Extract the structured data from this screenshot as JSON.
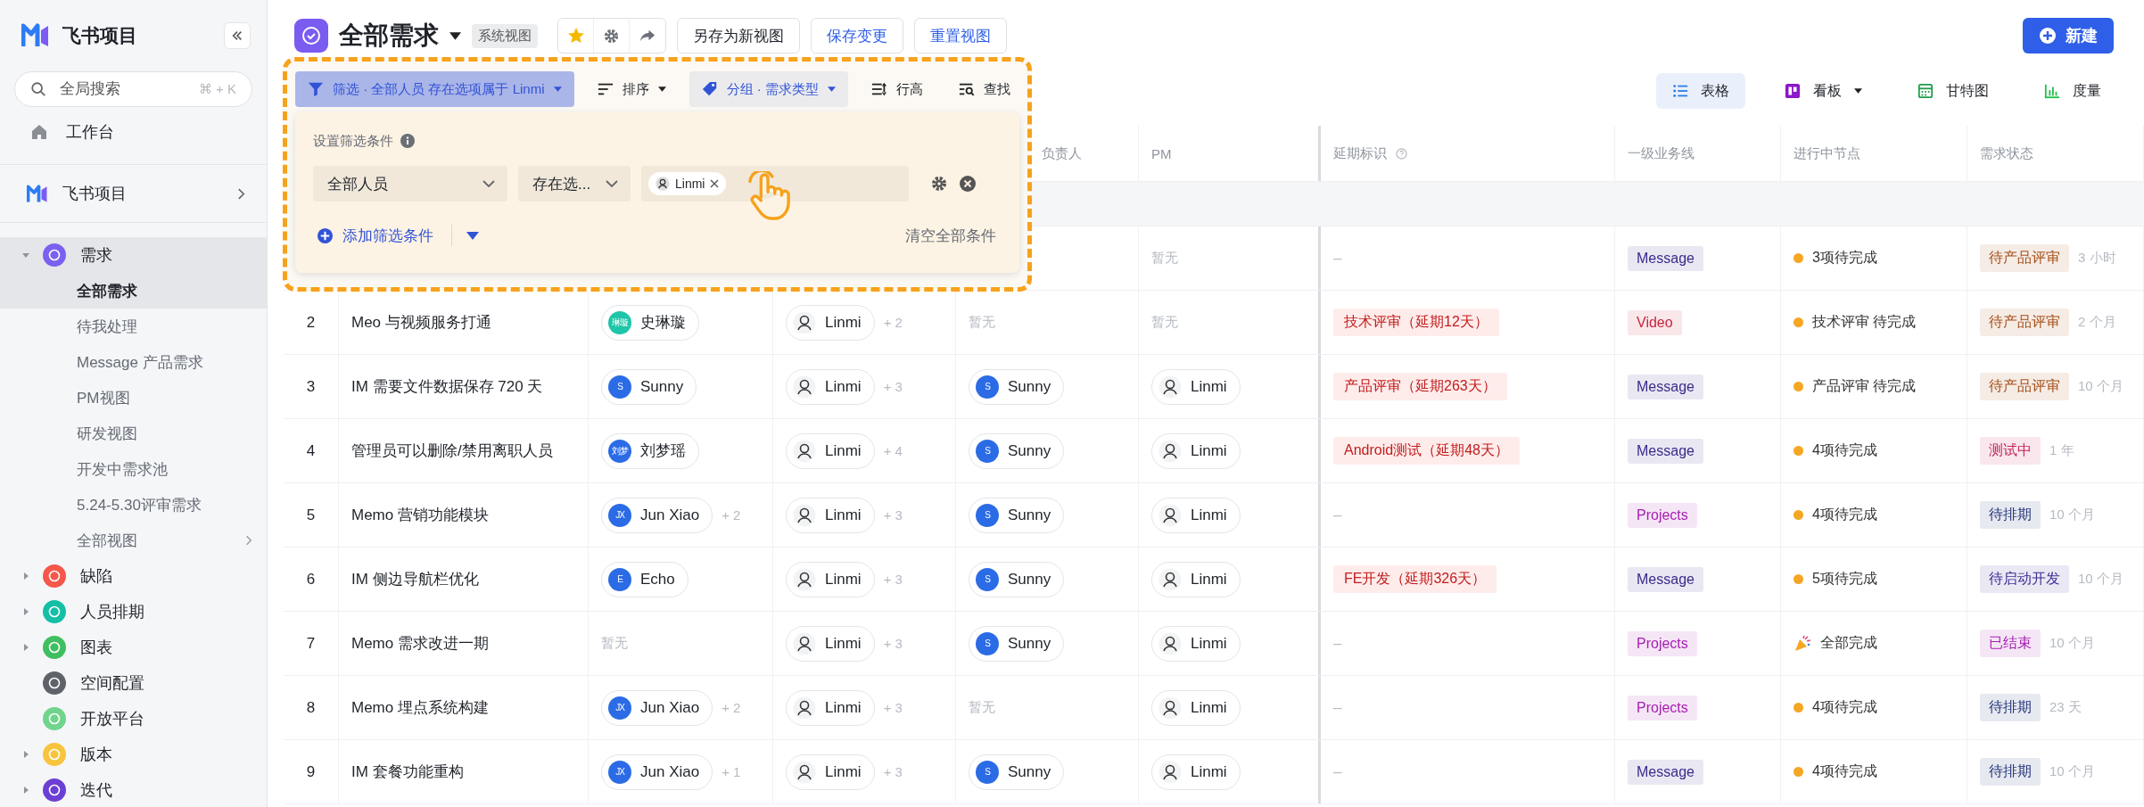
{
  "sidebar": {
    "title": "飞书项目",
    "search": {
      "placeholder": "全局搜索",
      "shortcut": "⌘ + K"
    },
    "home": "工作台",
    "space": "飞书项目",
    "nav": [
      {
        "label": "需求",
        "color": "#7b61f0",
        "kind": "group",
        "expanded": true,
        "selected": true,
        "children": [
          {
            "label": "全部需求",
            "selected": true,
            "more": false
          },
          {
            "label": "待我处理",
            "selected": false,
            "more": false
          },
          {
            "label": "Message 产品需求",
            "selected": false,
            "more": false
          },
          {
            "label": "PM视图",
            "selected": false,
            "more": false
          },
          {
            "label": "研发视图",
            "selected": false,
            "more": false
          },
          {
            "label": "开发中需求池",
            "selected": false,
            "more": false
          },
          {
            "label": "5.24-5.30评审需求",
            "selected": false,
            "more": false
          },
          {
            "label": "全部视图",
            "selected": false,
            "more": true
          }
        ]
      },
      {
        "label": "缺陷",
        "color": "#f5574a",
        "kind": "group",
        "expanded": false,
        "selected": false
      },
      {
        "label": "人员排期",
        "color": "#14bfa6",
        "kind": "group",
        "expanded": false,
        "selected": false
      },
      {
        "label": "图表",
        "color": "#3fbf5f",
        "kind": "group",
        "expanded": false,
        "selected": false
      },
      {
        "label": "空间配置",
        "color": "#5f6369",
        "kind": "link",
        "selected": false
      },
      {
        "label": "开放平台",
        "color": "#6fd48c",
        "kind": "link",
        "selected": false
      },
      {
        "label": "版本",
        "color": "#f7c43d",
        "kind": "group",
        "expanded": false,
        "selected": false
      },
      {
        "label": "迭代",
        "color": "#6b3fd4",
        "kind": "group",
        "expanded": false,
        "selected": false
      }
    ]
  },
  "header": {
    "title": "全部需求",
    "badge": "系统视图",
    "buttons": [
      {
        "label": "另存为新视图",
        "kind": "plain"
      },
      {
        "label": "保存变更",
        "kind": "primary_text"
      },
      {
        "label": "重置视图",
        "kind": "primary_text"
      }
    ],
    "new_button": "新建"
  },
  "toolbar": {
    "items": [
      {
        "label": "筛选 · 全部人员 存在选项属于 Linmi",
        "kind": "filter",
        "active": true,
        "dropdown": true
      },
      {
        "label": "排序",
        "kind": "sort",
        "active": false,
        "dropdown": true
      },
      {
        "label": "分组 · 需求类型",
        "kind": "group",
        "active": true,
        "dropdown": true
      },
      {
        "label": "行高",
        "kind": "height",
        "active": false,
        "dropdown": false
      },
      {
        "label": "查找",
        "kind": "find",
        "active": false,
        "dropdown": false
      }
    ],
    "views": [
      {
        "label": "表格",
        "kind": "table",
        "selected": true,
        "dropdown": false
      },
      {
        "label": "看板",
        "kind": "board",
        "selected": false,
        "dropdown": true
      },
      {
        "label": "甘特图",
        "kind": "gantt",
        "selected": false,
        "dropdown": false
      },
      {
        "label": "度量",
        "kind": "metric",
        "selected": false,
        "dropdown": false
      }
    ]
  },
  "filter_panel": {
    "title": "设置筛选条件",
    "field": "全部人员",
    "operator": "存在选...",
    "value": "Linmi",
    "add": "添加筛选条件",
    "clear": "清空全部条件"
  },
  "table": {
    "columns": [
      {
        "label": "负责人",
        "help": false
      },
      {
        "label": "PM",
        "help": false
      },
      {
        "label": "延期标识",
        "help": true
      },
      {
        "label": "一级业务线",
        "help": false
      },
      {
        "label": "进行中节点",
        "help": false
      },
      {
        "label": "需求状态",
        "help": false
      }
    ],
    "rows": [
      {
        "pm": {
          "empty": "暂无"
        },
        "delay": {
          "kind": "none",
          "text": "–"
        },
        "line": {
          "text": "Message",
          "color": "#3b2a8c"
        },
        "node": {
          "kind": "pending",
          "text": "3项待完成"
        },
        "status": {
          "text": "待产品评审",
          "color": "#a8501a"
        },
        "time": "3 小时"
      },
      {
        "index": "2",
        "title": "Meo 与视频服务打通",
        "column_3": {
          "name": "史琳璇",
          "avatar": {
            "kind": "initials",
            "text": "琳璇",
            "color": "#1fc5a8"
          }
        },
        "column_4": {
          "name": "Linmi",
          "avatar": {
            "kind": "portrait"
          },
          "extra": "+ 2"
        },
        "owner": {
          "empty": "暂无"
        },
        "pm": {
          "empty": "暂无"
        },
        "delay": {
          "kind": "late",
          "text": "技术评审（延期12天）"
        },
        "line": {
          "text": "Video",
          "color": "#c8253f"
        },
        "node": {
          "kind": "pending",
          "text": "技术评审 待完成"
        },
        "status": {
          "text": "待产品评审",
          "color": "#a8501a"
        },
        "time": "2 个月"
      },
      {
        "index": "3",
        "title": "IM 需要文件数据保存 720 天",
        "column_3": {
          "name": "Sunny",
          "avatar": {
            "kind": "initials",
            "text": "S",
            "color": "#2b6be6"
          }
        },
        "column_4": {
          "name": "Linmi",
          "avatar": {
            "kind": "portrait"
          },
          "extra": "+ 3"
        },
        "owner": {
          "name": "Sunny",
          "avatar": {
            "kind": "initials",
            "text": "S",
            "color": "#2b6be6"
          }
        },
        "pm": {
          "name": "Linmi",
          "avatar": {
            "kind": "portrait"
          }
        },
        "delay": {
          "kind": "late",
          "text": "产品评审（延期263天）"
        },
        "line": {
          "text": "Message",
          "color": "#3b2a8c"
        },
        "node": {
          "kind": "pending",
          "text": "产品评审 待完成"
        },
        "status": {
          "text": "待产品评审",
          "color": "#a8501a"
        },
        "time": "10 个月"
      },
      {
        "index": "4",
        "title": "管理员可以删除/禁用离职人员",
        "column_3": {
          "name": "刘梦瑶",
          "avatar": {
            "kind": "initials",
            "text": "刘梦",
            "color": "#2b6be6"
          }
        },
        "column_4": {
          "name": "Linmi",
          "avatar": {
            "kind": "portrait"
          },
          "extra": "+ 4"
        },
        "owner": {
          "name": "Sunny",
          "avatar": {
            "kind": "initials",
            "text": "S",
            "color": "#2b6be6"
          }
        },
        "pm": {
          "name": "Linmi",
          "avatar": {
            "kind": "portrait"
          }
        },
        "delay": {
          "kind": "late",
          "text": "Android测试（延期48天）"
        },
        "line": {
          "text": "Message",
          "color": "#3b2a8c"
        },
        "node": {
          "kind": "pending",
          "text": "4项待完成"
        },
        "status": {
          "text": "测试中",
          "color": "#c4245e"
        },
        "time": "1 年"
      },
      {
        "index": "5",
        "title": "Memo 营销功能模块",
        "column_3": {
          "name": "Jun Xiao",
          "avatar": {
            "kind": "initials",
            "text": "JX",
            "color": "#2b6be6"
          },
          "extra": "+ 2"
        },
        "column_4": {
          "name": "Linmi",
          "avatar": {
            "kind": "portrait"
          },
          "extra": "+ 3"
        },
        "owner": {
          "name": "Sunny",
          "avatar": {
            "kind": "initials",
            "text": "S",
            "color": "#2b6be6"
          }
        },
        "pm": {
          "name": "Linmi",
          "avatar": {
            "kind": "portrait"
          }
        },
        "delay": {
          "kind": "none",
          "text": "–"
        },
        "line": {
          "text": "Projects",
          "color": "#a51fb0"
        },
        "node": {
          "kind": "pending",
          "text": "4项待完成"
        },
        "status": {
          "text": "待排期",
          "color": "#26367a"
        },
        "time": "10 个月"
      },
      {
        "index": "6",
        "title": "IM 侧边导航栏优化",
        "column_3": {
          "name": "Echo",
          "avatar": {
            "kind": "initials",
            "text": "E",
            "color": "#2b6be6"
          }
        },
        "column_4": {
          "name": "Linmi",
          "avatar": {
            "kind": "portrait"
          },
          "extra": "+ 3"
        },
        "owner": {
          "name": "Sunny",
          "avatar": {
            "kind": "initials",
            "text": "S",
            "color": "#2b6be6"
          }
        },
        "pm": {
          "name": "Linmi",
          "avatar": {
            "kind": "portrait"
          }
        },
        "delay": {
          "kind": "late",
          "text": "FE开发（延期326天）"
        },
        "line": {
          "text": "Message",
          "color": "#3b2a8c"
        },
        "node": {
          "kind": "pending",
          "text": "5项待完成"
        },
        "status": {
          "text": "待启动开发",
          "color": "#3d2f94"
        },
        "time": "10 个月"
      },
      {
        "index": "7",
        "title": "Memo 需求改进一期",
        "column_3": {
          "empty": "暂无"
        },
        "column_4": {
          "name": "Linmi",
          "avatar": {
            "kind": "portrait"
          },
          "extra": "+ 3"
        },
        "owner": {
          "name": "Sunny",
          "avatar": {
            "kind": "initials",
            "text": "S",
            "color": "#2b6be6"
          }
        },
        "pm": {
          "name": "Linmi",
          "avatar": {
            "kind": "portrait"
          }
        },
        "delay": {
          "kind": "none",
          "text": "–"
        },
        "line": {
          "text": "Projects",
          "color": "#a51fb0"
        },
        "node": {
          "kind": "done",
          "text": "全部完成"
        },
        "status": {
          "text": "已结束",
          "color": "#a51fb0"
        },
        "time": "10 个月"
      },
      {
        "index": "8",
        "title": "Memo 埋点系统构建",
        "column_3": {
          "name": "Jun Xiao",
          "avatar": {
            "kind": "initials",
            "text": "JX",
            "color": "#2b6be6"
          },
          "extra": "+ 2"
        },
        "column_4": {
          "name": "Linmi",
          "avatar": {
            "kind": "portrait"
          },
          "extra": "+ 3"
        },
        "owner": {
          "empty": "暂无"
        },
        "pm": {
          "name": "Linmi",
          "avatar": {
            "kind": "portrait"
          }
        },
        "delay": {
          "kind": "none",
          "text": "–"
        },
        "line": {
          "text": "Projects",
          "color": "#a51fb0"
        },
        "node": {
          "kind": "pending",
          "text": "4项待完成"
        },
        "status": {
          "text": "待排期",
          "color": "#26367a"
        },
        "time": "23 天"
      },
      {
        "index": "9",
        "title": "IM 套餐功能重构",
        "column_3": {
          "name": "Jun Xiao",
          "avatar": {
            "kind": "initials",
            "text": "JX",
            "color": "#2b6be6"
          },
          "extra": "+ 1"
        },
        "column_4": {
          "name": "Linmi",
          "avatar": {
            "kind": "portrait"
          },
          "extra": "+ 3"
        },
        "owner": {
          "name": "Sunny",
          "avatar": {
            "kind": "initials",
            "text": "S",
            "color": "#2b6be6"
          }
        },
        "pm": {
          "name": "Linmi",
          "avatar": {
            "kind": "portrait"
          }
        },
        "delay": {
          "kind": "none",
          "text": "–"
        },
        "line": {
          "text": "Message",
          "color": "#3b2a8c"
        },
        "node": {
          "kind": "pending",
          "text": "4项待完成"
        },
        "status": {
          "text": "待排期",
          "color": "#26367a"
        },
        "time": "10 个月"
      }
    ]
  }
}
